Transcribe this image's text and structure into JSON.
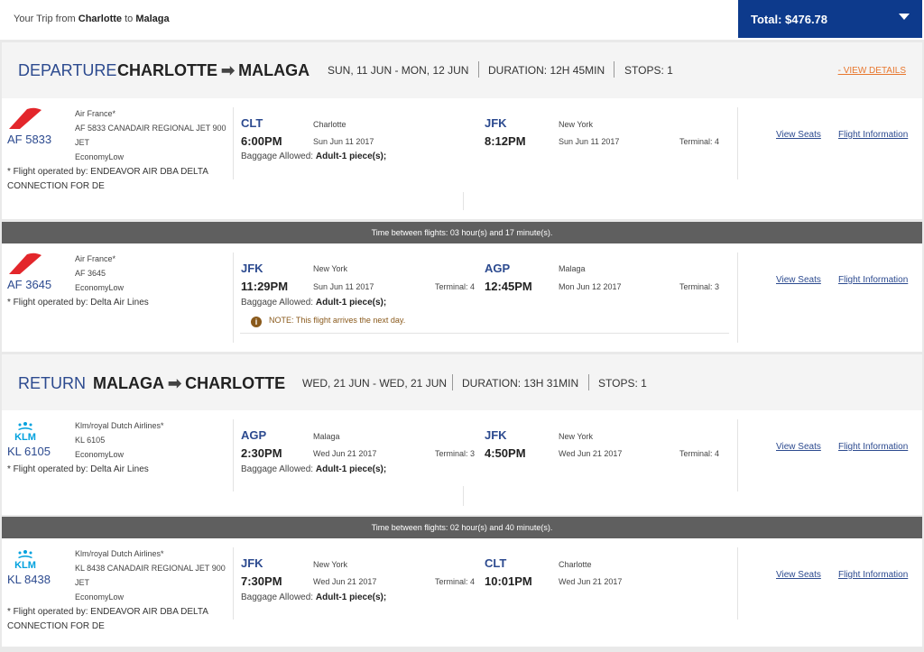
{
  "header": {
    "trip_prefix": "Your Trip from",
    "origin": "Charlotte",
    "to_word": "to",
    "destination": "Malaga",
    "total_label": "Total: $476.78"
  },
  "departure": {
    "label": "DEPARTURE",
    "from": "CHARLOTTE",
    "to": "MALAGA",
    "dates": "SUN, 11 JUN - MON, 12 JUN",
    "duration": "DURATION: 12H 45MIN",
    "stops": "STOPS: 1",
    "details_link": "- VIEW DETAILS"
  },
  "return": {
    "label": "RETURN",
    "from": "MALAGA",
    "to": "CHARLOTTE",
    "dates": "WED, 21 JUN - WED, 21 JUN",
    "duration": "DURATION: 13H 31MIN",
    "stops": "STOPS: 1"
  },
  "flights": [
    {
      "airline": "Air France*",
      "logo": "air-france-logo",
      "flight_number": "AF 5833",
      "detail": "AF 5833 CANADAIR REGIONAL JET 900 JET",
      "cabin": "EconomyLow",
      "operated_by": "* Flight operated by: ENDEAVOR AIR DBA DELTA CONNECTION FOR DE",
      "dep_code": "CLT",
      "dep_city": "Charlotte",
      "dep_time": "6:00PM",
      "dep_date": "Sun Jun 11 2017",
      "dep_terminal": "",
      "arr_code": "JFK",
      "arr_city": "New York",
      "arr_time": "8:12PM",
      "arr_date": "Sun Jun 11 2017",
      "arr_terminal": "Terminal: 4",
      "baggage_label": "Baggage Allowed:",
      "baggage_value": "Adult-1 piece(s);",
      "note": "",
      "view_seats": "View Seats",
      "flight_info": "Flight Information"
    },
    {
      "airline": "Air France*",
      "logo": "air-france-logo",
      "flight_number": "AF 3645",
      "detail": "AF 3645",
      "cabin": "EconomyLow",
      "operated_by": "* Flight operated by: Delta Air Lines",
      "dep_code": "JFK",
      "dep_city": "New York",
      "dep_time": "11:29PM",
      "dep_date": "Sun Jun 11 2017",
      "dep_terminal": "Terminal: 4",
      "arr_code": "AGP",
      "arr_city": "Malaga",
      "arr_time": "12:45PM",
      "arr_date": "Mon Jun 12 2017",
      "arr_terminal": "Terminal: 3",
      "baggage_label": "Baggage Allowed:",
      "baggage_value": "Adult-1 piece(s);",
      "note": "NOTE: This flight arrives the next day.",
      "view_seats": "View Seats",
      "flight_info": "Flight Information"
    },
    {
      "airline": "Klm/royal Dutch Airlines*",
      "logo": "klm-logo",
      "flight_number": "KL 6105",
      "detail": "KL 6105",
      "cabin": "EconomyLow",
      "operated_by": "* Flight operated by: Delta Air Lines",
      "dep_code": "AGP",
      "dep_city": "Malaga",
      "dep_time": "2:30PM",
      "dep_date": "Wed Jun 21 2017",
      "dep_terminal": "Terminal: 3",
      "arr_code": "JFK",
      "arr_city": "New York",
      "arr_time": "4:50PM",
      "arr_date": "Wed Jun 21 2017",
      "arr_terminal": "Terminal: 4",
      "baggage_label": "Baggage Allowed:",
      "baggage_value": "Adult-1 piece(s);",
      "note": "",
      "view_seats": "View Seats",
      "flight_info": "Flight Information"
    },
    {
      "airline": "Klm/royal Dutch Airlines*",
      "logo": "klm-logo",
      "flight_number": "KL 8438",
      "detail": "KL 8438 CANADAIR REGIONAL JET 900 JET",
      "cabin": "EconomyLow",
      "operated_by": "* Flight operated by: ENDEAVOR AIR DBA DELTA CONNECTION FOR DE",
      "dep_code": "JFK",
      "dep_city": "New York",
      "dep_time": "7:30PM",
      "dep_date": "Wed Jun 21 2017",
      "dep_terminal": "Terminal: 4",
      "arr_code": "CLT",
      "arr_city": "Charlotte",
      "arr_time": "10:01PM",
      "arr_date": "Wed Jun 21 2017",
      "arr_terminal": "",
      "baggage_label": "Baggage Allowed:",
      "baggage_value": "Adult-1 piece(s);",
      "note": "",
      "view_seats": "View Seats",
      "flight_info": "Flight Information"
    }
  ],
  "layovers": [
    "Time between flights: 03 hour(s) and 17 minute(s).",
    "Time between flights: 02 hour(s) and 40 minute(s)."
  ],
  "colors": {
    "brand_blue": "#0d3a8c",
    "link_blue": "#2c4a8f",
    "air_france_red": "#e3262b",
    "klm_blue": "#00a1de",
    "layover_bar": "#5f5f5f",
    "note_brown": "#8a5a1c",
    "details_orange": "#e8772e"
  }
}
